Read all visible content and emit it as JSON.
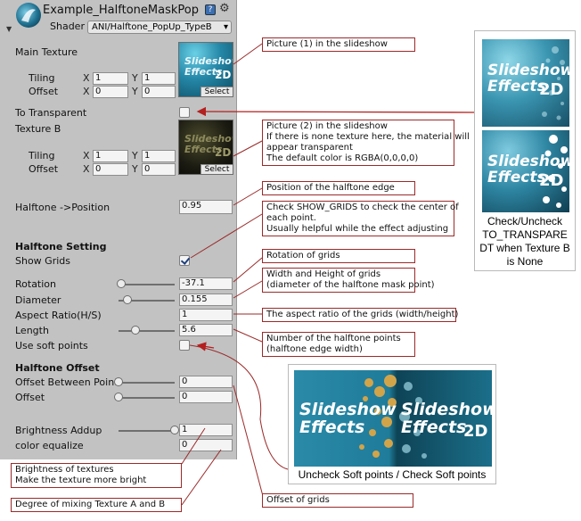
{
  "header": {
    "title": "Example_HalftoneMaskPopUp",
    "shader_label": "Shader",
    "shader_value": "ANI/Halftone_PopUp_TypeB"
  },
  "main_texture": {
    "label": "Main Texture",
    "tiling_label": "Tiling",
    "offset_label": "Offset",
    "x_label": "X",
    "y_label": "Y",
    "tiling_x": "1",
    "tiling_y": "1",
    "offset_x": "0",
    "offset_y": "0",
    "select_label": "Select",
    "thumb_text_1": "Slideshow",
    "thumb_text_2": "Effects",
    "thumb_text_3": "2D"
  },
  "to_transparent": {
    "label": "To Transparent",
    "checked": false
  },
  "texture_b": {
    "label": "Texture B",
    "tiling_label": "Tiling",
    "offset_label": "Offset",
    "x_label": "X",
    "y_label": "Y",
    "tiling_x": "1",
    "tiling_y": "1",
    "offset_x": "0",
    "offset_y": "0",
    "select_label": "Select"
  },
  "halftone_position": {
    "label": "Halftone ->Position",
    "value": "0.95"
  },
  "halftone_setting": {
    "heading": "Halftone Setting",
    "show_grids_label": "Show Grids",
    "show_grids": true,
    "rotation_label": "Rotation",
    "rotation_value": "-37.1",
    "rotation_level": 0.05,
    "diameter_label": "Diameter",
    "diameter_value": "0.155",
    "diameter_level": 0.16,
    "aspect_label": "Aspect Ratio(H/S)",
    "aspect_value": "1",
    "length_label": "Length",
    "length_value": "5.6",
    "length_level": 0.3,
    "soft_points_label": "Use soft points",
    "soft_points": false
  },
  "halftone_offset": {
    "heading": "Halftone Offset",
    "between_label": "Offset Between Points",
    "between_value": "0",
    "between_level": 0.0,
    "offset_label": "Offset",
    "offset_value": "0",
    "offset_level": 0.0
  },
  "brightness": {
    "label": "Brightness Addup",
    "value": "1",
    "level": 1.0,
    "equalize_label": "color equalize",
    "equalize_value": "0"
  },
  "callouts": {
    "picture1": "Picture (1) in the slideshow",
    "picture2_l1": "Picture (2) in the slideshow",
    "picture2_l2": "If there is none texture here, the material will",
    "picture2_l3": "appear transparent",
    "picture2_l4": "The default color is RGBA(0,0,0,0)",
    "position": "Position of the halftone edge",
    "showgrids_l1": "Check SHOW_GRIDS to check the center of",
    "showgrids_l2": "each point.",
    "showgrids_l3": "Usually helpful while the effect adjusting",
    "rotation": "Rotation of grids",
    "diameter_l1": "Width and Height of grids",
    "diameter_l2": "(diameter of the halftone mask point)",
    "aspect": "The aspect ratio of the grids (width/height)",
    "length_l1": "Number of the halftone points",
    "length_l2": " (halftone edge width)",
    "brightness_l1": "Brightness of textures",
    "brightness_l2": "Make the texture more bright",
    "mixing": "Degree of mixing Texture A and B",
    "offset_grids": "Offset of grids"
  },
  "right_caption": [
    "Check/Uncheck",
    "TO_TRANSPARE",
    "DT when Texture B",
    "is None"
  ],
  "bottom_caption": "Uncheck Soft points / Check Soft points",
  "colors": {
    "panel": "#c2c2c2",
    "callout_line": "#9b2a2a",
    "arrow": "#b3201f"
  }
}
